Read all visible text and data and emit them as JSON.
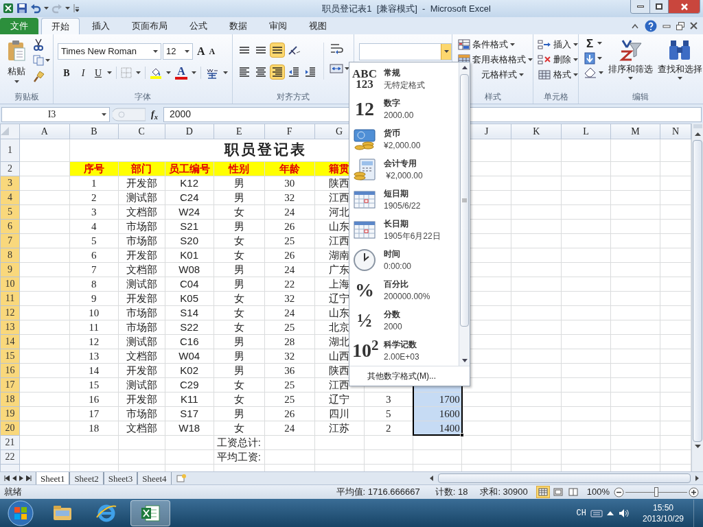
{
  "title_bar": {
    "title": "职员登记表1  [兼容模式]  -  Microsoft Excel"
  },
  "ribbon_tabs": [
    {
      "label": "文件",
      "kind": "file",
      "selected": false
    },
    {
      "label": "开始",
      "kind": "tab",
      "selected": true
    },
    {
      "label": "插入",
      "kind": "tab",
      "selected": false
    },
    {
      "label": "页面布局",
      "kind": "tab",
      "selected": false
    },
    {
      "label": "公式",
      "kind": "tab",
      "selected": false
    },
    {
      "label": "数据",
      "kind": "tab",
      "selected": false
    },
    {
      "label": "审阅",
      "kind": "tab",
      "selected": false
    },
    {
      "label": "视图",
      "kind": "tab",
      "selected": false
    }
  ],
  "clipboard": {
    "paste": "粘贴",
    "group": "剪贴板"
  },
  "font": {
    "name": "Times New Roman",
    "size": "12",
    "grow": "A",
    "shrink": "A",
    "bold": "B",
    "italic": "I",
    "underline": "U",
    "font_color": "A",
    "group": "字体"
  },
  "alignment": {
    "group": "对齐方式",
    "buttons": [
      {
        "kind": "top",
        "selected": false
      },
      {
        "kind": "middle",
        "selected": false
      },
      {
        "kind": "bottom",
        "selected": true
      },
      {
        "kind": "orientation",
        "selected": false
      },
      {
        "kind": "left",
        "selected": false
      },
      {
        "kind": "center",
        "selected": false
      },
      {
        "kind": "right",
        "selected": true
      },
      {
        "kind": "outdent",
        "selected": false
      },
      {
        "kind": "indent",
        "selected": false
      }
    ]
  },
  "styles": {
    "items": [
      {
        "kind": "conditional",
        "label": "条件格式"
      },
      {
        "kind": "table",
        "label": "套用表格格式"
      },
      {
        "kind": "cell",
        "label": "元格样式"
      }
    ],
    "group": "样式"
  },
  "cells": {
    "items": [
      {
        "kind": "insert",
        "label": "插入"
      },
      {
        "kind": "delete",
        "label": "删除"
      },
      {
        "kind": "format",
        "label": "格式"
      }
    ],
    "group": "单元格"
  },
  "editing": {
    "sum": "Σ",
    "sort": "排序和筛选",
    "find": "查找和选择",
    "group": "编辑"
  },
  "formula_bar": {
    "name_box": "I3",
    "function_button": "f$_{x}$",
    "value": "2000"
  },
  "sheet": {
    "columns": [
      {
        "label": "A"
      },
      {
        "label": "B"
      },
      {
        "label": "C"
      },
      {
        "label": "D"
      },
      {
        "label": "E"
      },
      {
        "label": "F"
      },
      {
        "label": "G"
      },
      {},
      {},
      {
        "label": "J"
      },
      {
        "label": "K"
      },
      {
        "label": "L"
      },
      {
        "label": "M"
      },
      {
        "label": "N"
      }
    ],
    "rows": [
      {
        "header": "1",
        "selected": false,
        "kind": "title",
        "title": "职员登记表"
      },
      {
        "header": "2",
        "selected": false,
        "kind": "heading",
        "cells": {
          "B": "序号",
          "C": "部门",
          "D": "员工编号",
          "E": "性别",
          "F": "年龄",
          "G": "籍贯"
        }
      },
      {
        "header": "3",
        "selected": true,
        "kind": "data",
        "cells": {
          "B": "1",
          "C": "开发部",
          "D": "K12",
          "E": "男",
          "F": "30",
          "G": "陕西"
        }
      },
      {
        "header": "4",
        "selected": true,
        "kind": "data",
        "cells": {
          "B": "2",
          "C": "测试部",
          "D": "C24",
          "E": "男",
          "F": "32",
          "G": "江西"
        }
      },
      {
        "header": "5",
        "selected": true,
        "kind": "data",
        "cells": {
          "B": "3",
          "C": "文档部",
          "D": "W24",
          "E": "女",
          "F": "24",
          "G": "河北"
        }
      },
      {
        "header": "6",
        "selected": true,
        "kind": "data",
        "cells": {
          "B": "4",
          "C": "市场部",
          "D": "S21",
          "E": "男",
          "F": "26",
          "G": "山东"
        }
      },
      {
        "header": "7",
        "selected": true,
        "kind": "data",
        "cells": {
          "B": "5",
          "C": "市场部",
          "D": "S20",
          "E": "女",
          "F": "25",
          "G": "江西"
        }
      },
      {
        "header": "8",
        "selected": true,
        "kind": "data",
        "cells": {
          "B": "6",
          "C": "开发部",
          "D": "K01",
          "E": "女",
          "F": "26",
          "G": "湖南"
        }
      },
      {
        "header": "9",
        "selected": true,
        "kind": "data",
        "cells": {
          "B": "7",
          "C": "文档部",
          "D": "W08",
          "E": "男",
          "F": "24",
          "G": "广东"
        }
      },
      {
        "header": "10",
        "selected": true,
        "kind": "data",
        "cells": {
          "B": "8",
          "C": "测试部",
          "D": "C04",
          "E": "男",
          "F": "22",
          "G": "上海"
        }
      },
      {
        "header": "11",
        "selected": true,
        "kind": "data",
        "cells": {
          "B": "9",
          "C": "开发部",
          "D": "K05",
          "E": "女",
          "F": "32",
          "G": "辽宁"
        }
      },
      {
        "header": "12",
        "selected": true,
        "kind": "data",
        "cells": {
          "B": "10",
          "C": "市场部",
          "D": "S14",
          "E": "女",
          "F": "24",
          "G": "山东"
        }
      },
      {
        "header": "13",
        "selected": true,
        "kind": "data",
        "cells": {
          "B": "11",
          "C": "市场部",
          "D": "S22",
          "E": "女",
          "F": "25",
          "G": "北京"
        }
      },
      {
        "header": "14",
        "selected": true,
        "kind": "data",
        "cells": {
          "B": "12",
          "C": "测试部",
          "D": "C16",
          "E": "男",
          "F": "28",
          "G": "湖北"
        }
      },
      {
        "header": "15",
        "selected": true,
        "kind": "data",
        "cells": {
          "B": "13",
          "C": "文档部",
          "D": "W04",
          "E": "男",
          "F": "32",
          "G": "山西"
        }
      },
      {
        "header": "16",
        "selected": true,
        "kind": "data",
        "cells": {
          "B": "14",
          "C": "开发部",
          "D": "K02",
          "E": "男",
          "F": "36",
          "G": "陕西"
        }
      },
      {
        "header": "17",
        "selected": true,
        "kind": "data",
        "cells": {
          "B": "15",
          "C": "测试部",
          "D": "C29",
          "E": "女",
          "F": "25",
          "G": "江西",
          "I": {
            "selected": true
          }
        }
      },
      {
        "header": "18",
        "selected": true,
        "kind": "data",
        "cells": {
          "B": "16",
          "C": "开发部",
          "D": "K11",
          "E": "女",
          "F": "25",
          "G": "辽宁",
          "H": "3",
          "I": {
            "text": "1700",
            "selected": true
          }
        }
      },
      {
        "header": "19",
        "selected": true,
        "kind": "data",
        "cells": {
          "B": "17",
          "C": "市场部",
          "D": "S17",
          "E": "男",
          "F": "26",
          "G": "四川",
          "H": "5",
          "I": {
            "text": "1600",
            "selected": true
          }
        }
      },
      {
        "header": "20",
        "selected": true,
        "kind": "data",
        "cells": {
          "B": "18",
          "C": "文档部",
          "D": "W18",
          "E": "女",
          "F": "24",
          "G": "江苏",
          "H": "2",
          "I": {
            "text": "1400",
            "selected": true
          }
        }
      },
      {
        "header": "21",
        "selected": false,
        "kind": "data",
        "cells": {
          "E": "工资总计:"
        }
      },
      {
        "header": "22",
        "selected": false,
        "kind": "data",
        "cells": {
          "E": "平均工资:"
        }
      }
    ]
  },
  "number_format_menu": {
    "items": [
      {
        "kind": "general",
        "icon_text": [
          "ABC",
          "123"
        ],
        "label": "常规",
        "example": "无特定格式"
      },
      {
        "kind": "number",
        "icon_text": [
          "12"
        ],
        "label": "数字",
        "example": "2000.00"
      },
      {
        "kind": "currency",
        "label": "货币",
        "example": "¥2,000.00"
      },
      {
        "kind": "accounting",
        "label": "会计专用",
        "example": " ¥2,000.00"
      },
      {
        "kind": "short_date",
        "label": "短日期",
        "example": "1905/6/22"
      },
      {
        "kind": "long_date",
        "label": "长日期",
        "example": "1905年6月22日"
      },
      {
        "kind": "time",
        "label": "时间",
        "example": "0:00:00"
      },
      {
        "kind": "percent",
        "icon_text": [
          "%"
        ],
        "label": "百分比",
        "example": "200000.00%"
      },
      {
        "kind": "fraction",
        "icon_text": [
          "½"
        ],
        "label": "分数",
        "example": "2000"
      },
      {
        "kind": "scientific",
        "icon_text": [
          "10$^{2}$"
        ],
        "label": "科学记数",
        "example": "2.00E+03"
      }
    ],
    "more": "其他数字格式(M)..."
  },
  "sheet_tabs": [
    {
      "label": "Sheet1",
      "selected": true
    },
    {
      "label": "Sheet2",
      "selected": false
    },
    {
      "label": "Sheet3",
      "selected": false
    },
    {
      "label": "Sheet4",
      "selected": false
    }
  ],
  "status_bar": {
    "ready": "就绪",
    "average": "平均值: 1716.666667",
    "count": "计数: 18",
    "sum": "求和: 30900",
    "views": [
      {
        "kind": "normal",
        "selected": true
      },
      {
        "kind": "layout",
        "selected": false
      },
      {
        "kind": "break",
        "selected": false
      }
    ],
    "zoom": "100%",
    "zoom_slider": {
      "level": 0.5
    }
  },
  "taskbar": {
    "apps": [
      {
        "kind": "explorer",
        "selected": false
      },
      {
        "kind": "browser",
        "selected": false
      },
      {
        "kind": "excel",
        "selected": true
      }
    ],
    "language": "CH",
    "time": "15:50",
    "date": "2013/10/29"
  }
}
